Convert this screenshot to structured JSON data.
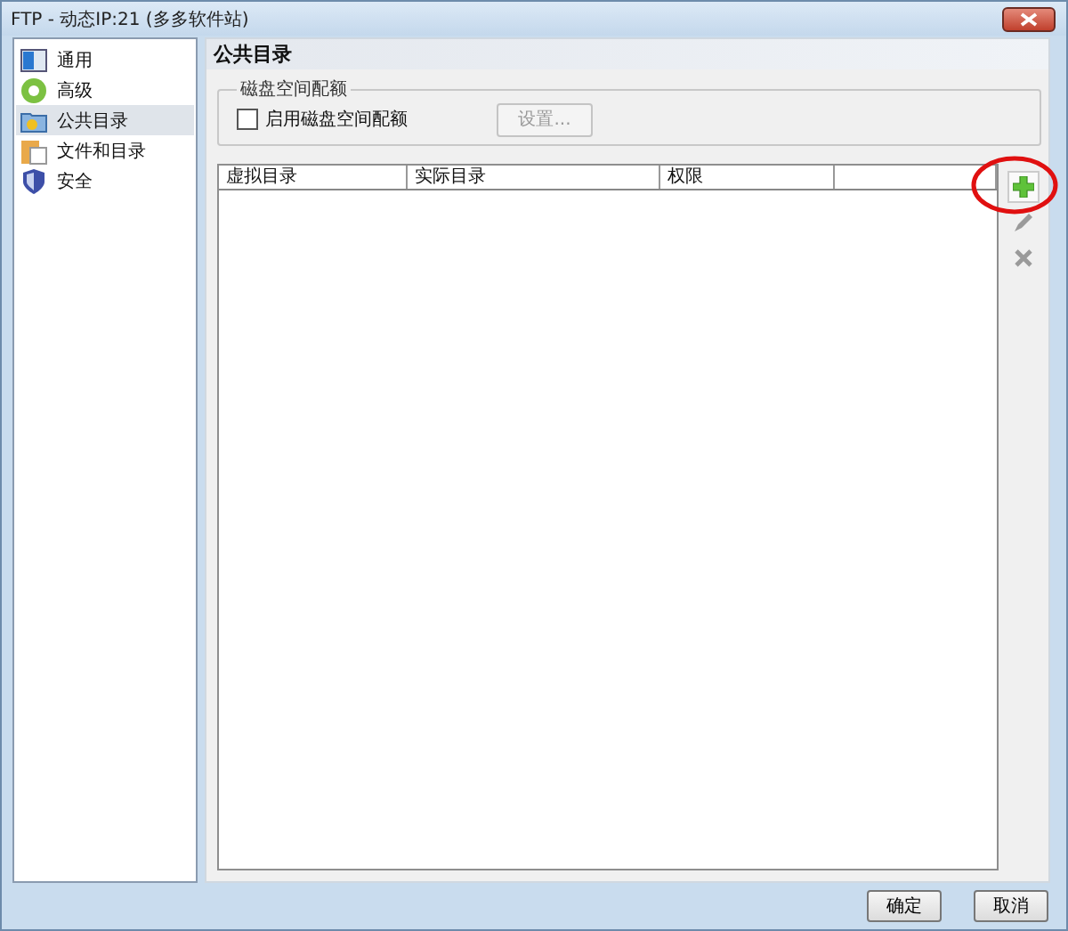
{
  "window": {
    "title": "FTP - 动态IP:21 (多多软件站)"
  },
  "sidebar": {
    "items": [
      {
        "label": "通用",
        "kind": "general",
        "selected": false
      },
      {
        "label": "高级",
        "kind": "advanced",
        "selected": false
      },
      {
        "label": "公共目录",
        "kind": "public",
        "selected": true
      },
      {
        "label": "文件和目录",
        "kind": "files",
        "selected": false
      },
      {
        "label": "安全",
        "kind": "security",
        "selected": false
      }
    ]
  },
  "panel": {
    "title": "公共目录",
    "quota_group": {
      "legend": "磁盘空间配额",
      "checkbox": {
        "label": "启用磁盘空间配额",
        "checked": false
      },
      "settings_button": {
        "label": "设置...",
        "disabled": true
      }
    },
    "table": {
      "columns": [
        "虚拟目录",
        "实际目录",
        "权限",
        ""
      ]
    },
    "toolbar": [
      {
        "kind": "add",
        "disabled": false,
        "highlighted": true
      },
      {
        "kind": "edit",
        "disabled": true,
        "highlighted": false
      },
      {
        "kind": "delete",
        "disabled": true,
        "highlighted": false
      }
    ]
  },
  "buttons": [
    "确定",
    "取消"
  ]
}
